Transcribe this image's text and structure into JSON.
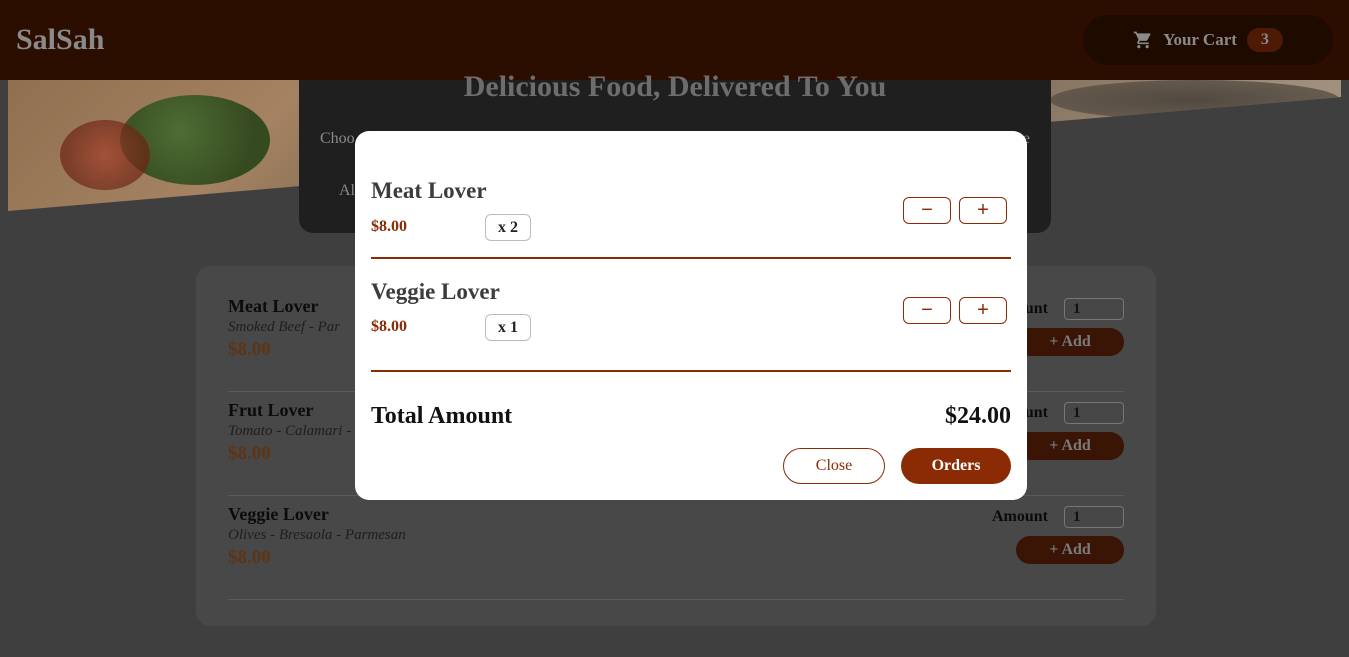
{
  "header": {
    "logo": "SalSah",
    "cart_label": "Your Cart",
    "cart_count": "3",
    "cart_icon": "cart-icon"
  },
  "summary": {
    "title": "Delicious Food, Delivered To You",
    "text_left": "Choo",
    "text_right": "e",
    "text_second": "Al"
  },
  "meals": [
    {
      "name": "Meat Lover",
      "description": "Smoked Beef - Par",
      "price": "$8.00",
      "amount_label": "unt",
      "amount_value": "1",
      "add_label": "+ Add"
    },
    {
      "name": "Frut Lover",
      "description": "Tomato - Calamari -",
      "price": "$8.00",
      "amount_label": "unt",
      "amount_value": "1",
      "add_label": "+ Add"
    },
    {
      "name": "Veggie Lover",
      "description": "Olives - Bresaola - Parmesan",
      "price": "$8.00",
      "amount_label": "Amount",
      "amount_value": "1",
      "add_label": "+ Add"
    }
  ],
  "cart_modal": {
    "items": [
      {
        "name": "Meat Lover",
        "price": "$8.00",
        "quantity": "x 2",
        "remove_label": "−",
        "add_label": "+"
      },
      {
        "name": "Veggie Lover",
        "price": "$8.00",
        "quantity": "x 1",
        "remove_label": "−",
        "add_label": "+"
      }
    ],
    "total_label": "Total Amount",
    "total_value": "$24.00",
    "close_label": "Close",
    "order_label": "Orders"
  },
  "colors": {
    "brand": "#8a2b06",
    "header_bg": "#2b0e00",
    "modal_bg": "#ffffff"
  }
}
